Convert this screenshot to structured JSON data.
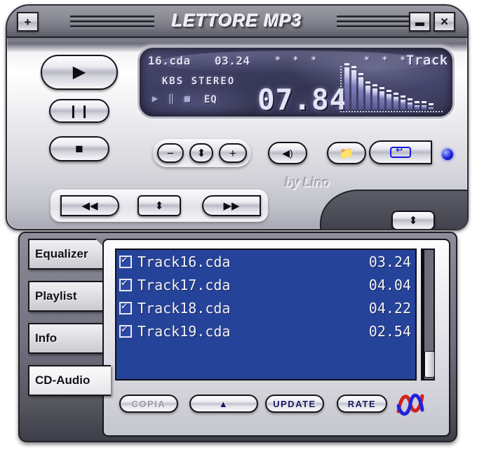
{
  "window": {
    "title": "LETTORE MP3",
    "expand_label": "+",
    "minimize_label": "—",
    "close_label": "✕",
    "credit": "by Lino"
  },
  "display": {
    "file": "16.cda",
    "total_time": "03.24",
    "stars_left": "* * *",
    "stars_right": "* * *",
    "track_label": "Track",
    "bitrate_mode": "KBS STEREO",
    "indicators": "▶ ‖ ■",
    "eq_label": "EQ",
    "elapsed": "07.84",
    "spectrum_levels": [
      60,
      56,
      46,
      34,
      30,
      26,
      22,
      18,
      14,
      10,
      6,
      6,
      3
    ]
  },
  "transport": {
    "play_label": "▶",
    "pause_label": "❙❙",
    "stop_label": "■",
    "prev_label": "◀◀",
    "next_label": "▶▶",
    "seek_label": "⬍",
    "wing_label": "⬍"
  },
  "controls": {
    "volume_down_label": "−",
    "volume_step_label": "⬍",
    "volume_up_label": "+",
    "mute_label": "◀)",
    "open_label": "📁",
    "repeat_label": "repeat-loop",
    "led_label": "led-indicator"
  },
  "tabs": [
    {
      "label": "Equalizer",
      "active": false
    },
    {
      "label": "Playlist",
      "active": false
    },
    {
      "label": "Info",
      "active": false
    },
    {
      "label": "CD-Audio",
      "active": true
    }
  ],
  "tracklist": {
    "rows": [
      {
        "checked": true,
        "name": "Track16.cda",
        "time": "03.24"
      },
      {
        "checked": true,
        "name": "Track17.cda",
        "time": "04.04"
      },
      {
        "checked": true,
        "name": "Track18.cda",
        "time": "04.22"
      },
      {
        "checked": true,
        "name": "Track19.cda",
        "time": "02.54"
      }
    ]
  },
  "actions": {
    "copia_label": "COPIA",
    "eject_label": "▲",
    "update_label": "UPDATE",
    "rate_label": "RATE"
  },
  "colors": {
    "lcd_bg": "#3c3c60",
    "lcd_text": "#dfdff2",
    "list_bg": "#26439a",
    "panel_bg": "#6e6e7d",
    "accent_blue": "#1717e0",
    "logo_red": "#d32020"
  }
}
